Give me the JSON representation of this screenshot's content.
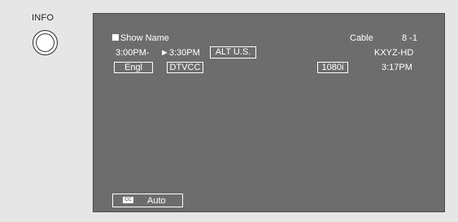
{
  "remote": {
    "info_label": "INFO"
  },
  "banner": {
    "show_name": "Show Name",
    "source": "Cable",
    "channel": "8 -1",
    "start_time": "3:00PM-",
    "end_time": "►3:30PM",
    "rating": "ALT U.S.",
    "station": "KXYZ-HD",
    "audio_language": "Engl",
    "caption_type": "DTVCC",
    "resolution": "1080i",
    "current_time": "3:17PM"
  },
  "closed_caption": {
    "icon_text": "CC",
    "mode": "Auto"
  },
  "colors": {
    "screen_bg": "#6d6d6d",
    "page_bg": "#e6e6e6",
    "text": "#ffffff"
  },
  "icons": {
    "info_button": "circle-button-icon",
    "cc": "closed-caption-icon"
  }
}
